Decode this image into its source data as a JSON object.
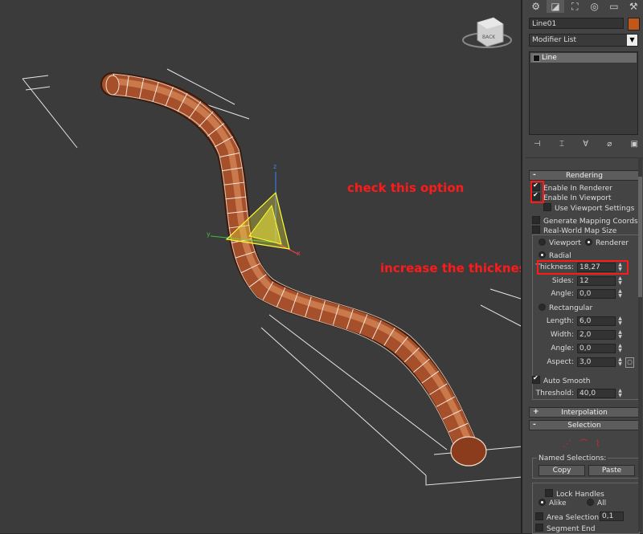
{
  "annotations": {
    "check_option": "check this option",
    "increase_thickness": "increase the thickness"
  },
  "viewport": {
    "viewcube_label": "BACK",
    "gizmo_axes": {
      "x": "x",
      "y": "y",
      "z": "z"
    }
  },
  "command_panel": {
    "tab_icons": [
      "gear-icon",
      "hierarchy-icon",
      "motion-icon",
      "display-icon",
      "utilities-icon",
      "hammer-icon"
    ],
    "object_name": "Line01",
    "object_color": "#c2571a",
    "modifier_list": "Modifier List",
    "stack": [
      {
        "label": "Line"
      }
    ],
    "rendering": {
      "title": "Rendering",
      "enable_in_renderer": "Enable In Renderer",
      "enable_in_viewport": "Enable In Viewport",
      "use_viewport_settings": "Use Viewport Settings",
      "generate_mapping": "Generate Mapping Coords.",
      "real_world_map": "Real-World Map Size",
      "viewport": "Viewport",
      "renderer": "Renderer",
      "radial": "Radial",
      "thickness_label": "Thickness:",
      "thickness_value": "18,27",
      "sides_label": "Sides:",
      "sides_value": "12",
      "angle_label": "Angle:",
      "angle_value": "0,0",
      "rectangular": "Rectangular",
      "length_label": "Length:",
      "length_value": "6,0",
      "width_label": "Width:",
      "width_value": "2,0",
      "rect_angle_label": "Angle:",
      "rect_angle_value": "0,0",
      "aspect_label": "Aspect:",
      "aspect_value": "3,0",
      "auto_smooth": "Auto Smooth",
      "threshold_label": "Threshold:",
      "threshold_value": "40,0"
    },
    "interpolation": {
      "title": "Interpolation"
    },
    "selection": {
      "title": "Selection",
      "named_selections": "Named Selections:",
      "copy": "Copy",
      "paste": "Paste",
      "lock_handles": "Lock Handles",
      "alike": "Alike",
      "all": "All",
      "area_selection": "Area Selection:",
      "area_value": "0,1",
      "segment_end": "Segment End"
    }
  }
}
